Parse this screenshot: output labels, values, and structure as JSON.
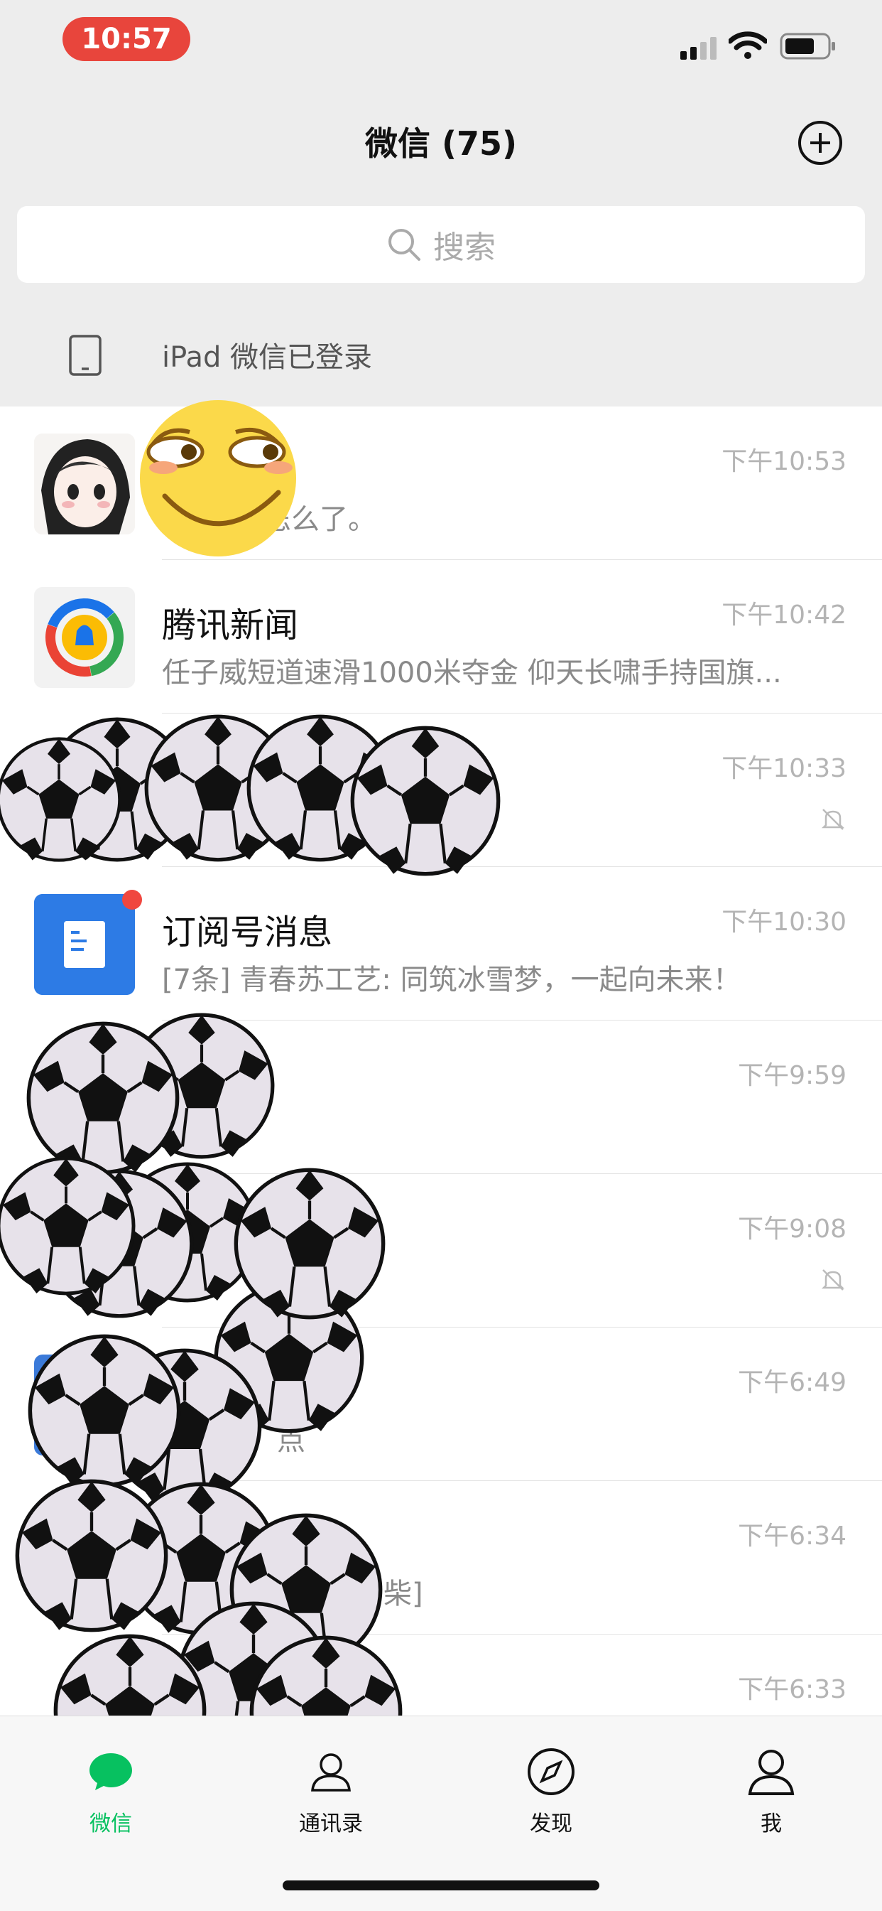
{
  "status_bar": {
    "time": "10:57"
  },
  "header": {
    "title": "微信 (75)"
  },
  "search": {
    "placeholder": "搜索"
  },
  "device_notice": {
    "text": "iPad 微信已登录"
  },
  "chats": [
    {
      "name": "",
      "preview": "玩。怎么了。",
      "time": "下午10:53",
      "muted": false
    },
    {
      "name": "腾讯新闻",
      "preview": "任子威短道速滑1000米夺金 仰天长啸手持国旗...",
      "time": "下午10:42",
      "muted": false
    },
    {
      "name": "",
      "preview": "",
      "time": "下午10:33",
      "muted": true
    },
    {
      "name": "订阅号消息",
      "preview": "[7条] 青春苏工艺: 同筑冰雪梦，一起向未来！",
      "time": "下午10:30",
      "muted": false
    },
    {
      "name": "",
      "preview": "",
      "time": "下午9:59",
      "muted": false
    },
    {
      "name": "",
      "preview": "",
      "time": "下午9:08",
      "muted": true
    },
    {
      "name": "",
      "preview": "点",
      "time": "下午6:49",
      "muted": false
    },
    {
      "name": "",
      "preview": "柴]",
      "time": "下午6:34",
      "muted": false
    },
    {
      "name": "",
      "preview": "",
      "time": "下午6:33",
      "muted": false
    }
  ],
  "tabs": [
    {
      "label": "微信",
      "icon": "chat-bubble-icon",
      "active": true
    },
    {
      "label": "通讯录",
      "icon": "contacts-icon",
      "active": false
    },
    {
      "label": "发现",
      "icon": "compass-icon",
      "active": false
    },
    {
      "label": "我",
      "icon": "person-icon",
      "active": false
    }
  ],
  "colors": {
    "accent": "#07c160",
    "badge": "#f0473f",
    "time_pill": "#e8453c"
  }
}
